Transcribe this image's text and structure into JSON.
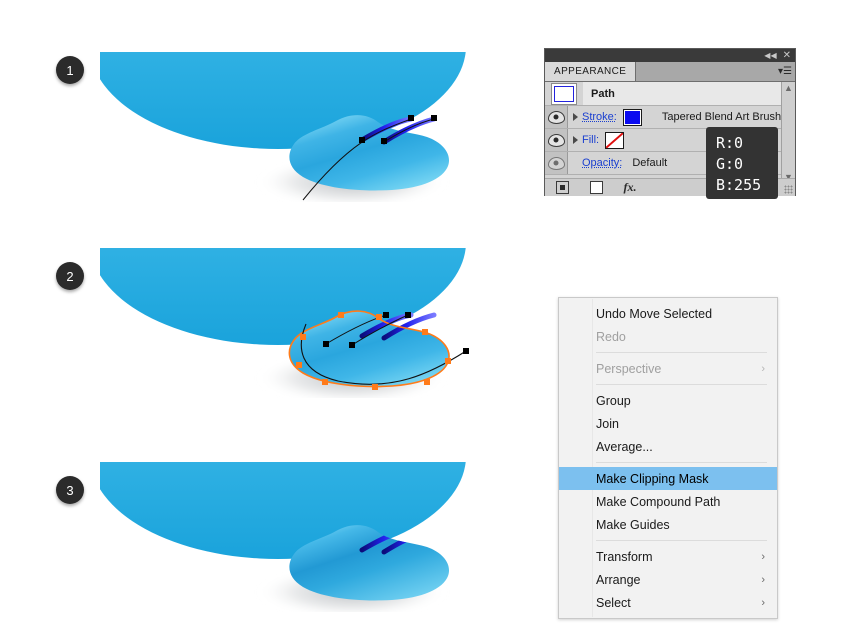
{
  "steps": [
    {
      "number": "1"
    },
    {
      "number": "2"
    },
    {
      "number": "3"
    }
  ],
  "appearance_panel": {
    "tab_label": "APPEARANCE",
    "collapse_icon": "collapse-double-arrow-icon",
    "close_icon": "close-icon",
    "panel_menu_icon": "panel-menu-icon",
    "object_row": {
      "title": "Path"
    },
    "rows": [
      {
        "label": "Stroke:",
        "value": "Tapered Blend Art Brush",
        "swatch_color": "#0a0af0",
        "visible": true
      },
      {
        "label": "Fill:",
        "value": "",
        "swatch_color": "none",
        "visible": true
      },
      {
        "label": "Opacity:",
        "value": "Default",
        "visible": true
      }
    ],
    "footer_icons": [
      "add-new-stroke-icon",
      "add-new-fill-icon",
      "add-new-effect-icon",
      "clear-appearance-icon"
    ],
    "scroll_up_icon": "chevron-up-icon",
    "scroll_down_icon": "chevron-down-icon",
    "resize_grip_icon": "resize-grip-icon"
  },
  "rgb_tooltip": {
    "r": "R:0",
    "g": "G:0",
    "b": "B:255"
  },
  "context_menu": {
    "items": [
      {
        "label": "Undo Move Selected",
        "disabled": false,
        "submenu": false,
        "highlight": false
      },
      {
        "label": "Redo",
        "disabled": true,
        "submenu": false,
        "highlight": false
      },
      {
        "separator": true
      },
      {
        "label": "Perspective",
        "disabled": true,
        "submenu": true,
        "highlight": false
      },
      {
        "separator": true
      },
      {
        "label": "Group",
        "disabled": false,
        "submenu": false,
        "highlight": false
      },
      {
        "label": "Join",
        "disabled": false,
        "submenu": false,
        "highlight": false
      },
      {
        "label": "Average...",
        "disabled": false,
        "submenu": false,
        "highlight": false
      },
      {
        "separator": true
      },
      {
        "label": "Make Clipping Mask",
        "disabled": false,
        "submenu": false,
        "highlight": true
      },
      {
        "label": "Make Compound Path",
        "disabled": false,
        "submenu": false,
        "highlight": false
      },
      {
        "label": "Make Guides",
        "disabled": false,
        "submenu": false,
        "highlight": false
      },
      {
        "separator": true
      },
      {
        "label": "Transform",
        "disabled": false,
        "submenu": true,
        "highlight": false
      },
      {
        "label": "Arrange",
        "disabled": false,
        "submenu": true,
        "highlight": false
      },
      {
        "label": "Select",
        "disabled": false,
        "submenu": true,
        "highlight": false
      }
    ],
    "submenu_arrow": "chevron-right-icon"
  },
  "illustration": {
    "bowl_color_top": "#ffffff",
    "bowl_color_mid": "#35b3e2",
    "bowl_color_bottom": "#1fa8de",
    "blob_color_light": "#6ed2f2",
    "blob_color_mid": "#2ba9e0",
    "blob_color_dark": "#1a7fc0",
    "stroke_blue": "#2020e8",
    "selection_color": "#ff7b1a",
    "anchor_color": "#000000"
  }
}
